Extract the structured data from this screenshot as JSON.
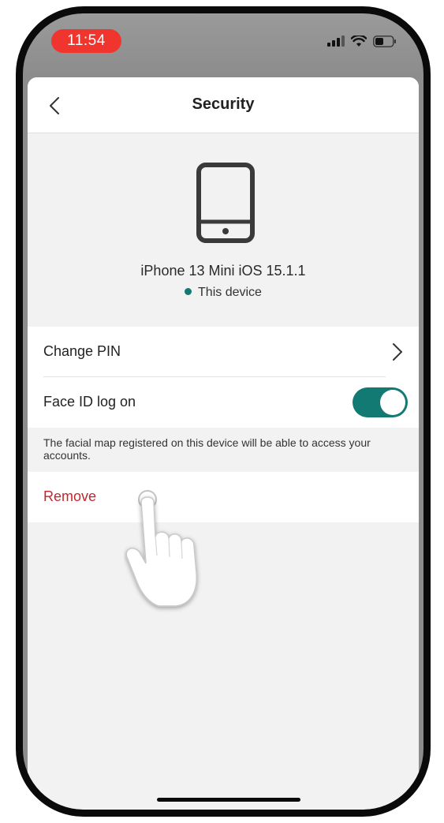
{
  "status_bar": {
    "time": "11:54",
    "icons": [
      "signal-icon",
      "wifi-icon",
      "battery-icon"
    ]
  },
  "nav": {
    "title": "Security",
    "back_icon": "chevron-left-icon"
  },
  "device": {
    "icon": "smartphone-icon",
    "name": "iPhone 13 Mini iOS 15.1.1",
    "status": "This device",
    "status_color": "#137a73"
  },
  "settings": {
    "change_pin_label": "Change PIN",
    "face_id_label": "Face ID log on",
    "face_id_enabled": true,
    "helper_text": "The facial map registered on this device will be able to access your accounts.",
    "remove_label": "Remove"
  },
  "colors": {
    "accent": "#137a73",
    "danger": "#c4262e",
    "time_pill": "#f0352e"
  }
}
